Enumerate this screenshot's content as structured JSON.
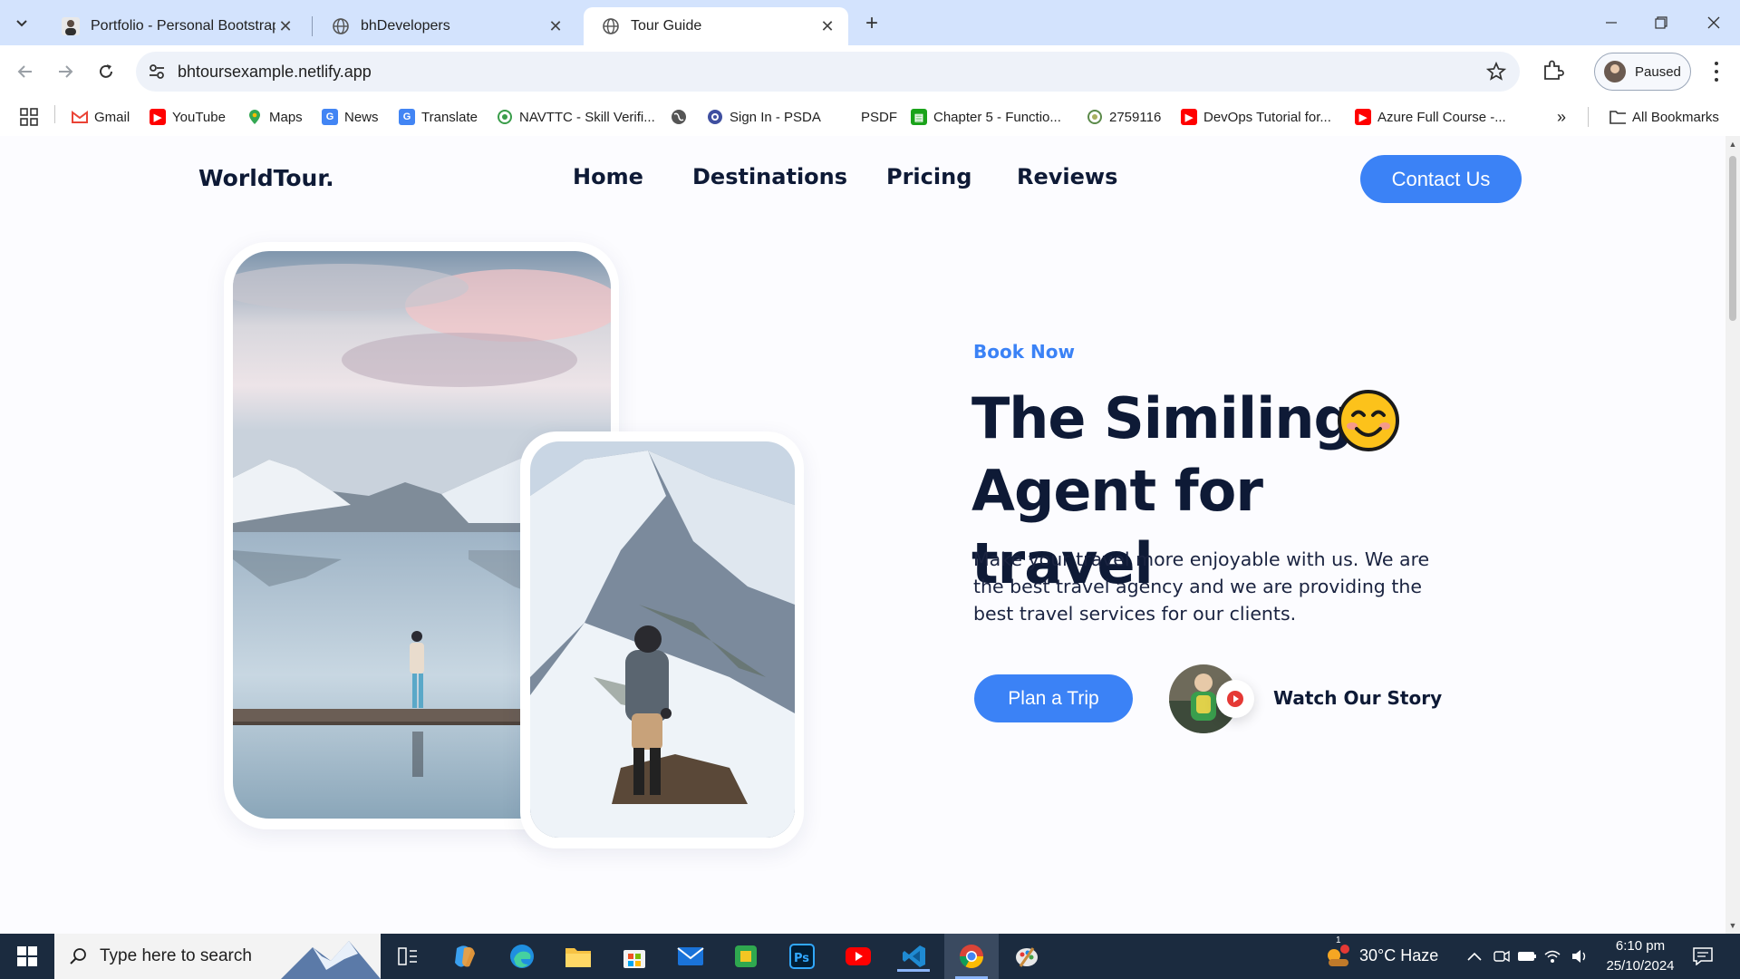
{
  "tabs": [
    {
      "title": "Portfolio - Personal Bootstrap Te",
      "active": false,
      "icon": "profile-photo-icon"
    },
    {
      "title": "bhDevelopers",
      "active": false,
      "icon": "globe-icon"
    },
    {
      "title": "Tour Guide",
      "active": true,
      "icon": "globe-icon"
    }
  ],
  "toolbar": {
    "url": "bhtoursexample.netlify.app",
    "profile_label": "Paused"
  },
  "bookmarks": [
    {
      "label": "Gmail",
      "icon": "gmail-icon"
    },
    {
      "label": "YouTube",
      "icon": "youtube-icon"
    },
    {
      "label": "Maps",
      "icon": "maps-icon"
    },
    {
      "label": "News",
      "icon": "news-icon"
    },
    {
      "label": "Translate",
      "icon": "translate-icon"
    },
    {
      "label": "NAVTTC - Skill Verifi...",
      "icon": "navttc-icon"
    },
    {
      "label": "",
      "icon": "globe-icon"
    },
    {
      "label": "Sign In - PSDA",
      "icon": "psda-icon"
    },
    {
      "label": "PSDF",
      "icon": "blank-icon"
    },
    {
      "label": "Chapter 5 - Functio...",
      "icon": "sheet-icon"
    },
    {
      "label": "2759116",
      "icon": "seal-icon"
    },
    {
      "label": "DevOps Tutorial for...",
      "icon": "youtube-icon"
    },
    {
      "label": "Azure Full Course -...",
      "icon": "youtube-icon"
    }
  ],
  "all_bookmarks_label": "All Bookmarks",
  "site": {
    "logo": "WorldTour.",
    "nav": [
      "Home",
      "Destinations",
      "Pricing",
      "Reviews"
    ],
    "contact_button": "Contact Us",
    "book_now": "Book Now",
    "headline_line1": "The Similing",
    "headline_line2": "Agent for travel",
    "description": "Make your travel more enjoyable with us. We are the best travel agency and we are providing the best travel services for our clients.",
    "plan_button": "Plan a Trip",
    "watch_story": "Watch Our Story"
  },
  "colors": {
    "accent": "#3b82f6",
    "heading": "#0e1a36",
    "tabstrip": "#d3e3fd",
    "taskbar": "#1b2b3f"
  },
  "taskbar": {
    "search_placeholder": "Type here to search",
    "weather": "30°C  Haze",
    "weather_badge": "1",
    "time": "6:10 pm",
    "date": "25/10/2024",
    "apps": [
      "task-view-icon",
      "copilot-icon",
      "edge-icon",
      "file-explorer-icon",
      "store-icon",
      "mail-icon",
      "green-app-icon",
      "photoshop-icon",
      "youtube-icon",
      "vscode-icon",
      "chrome-icon",
      "paint-icon"
    ]
  }
}
